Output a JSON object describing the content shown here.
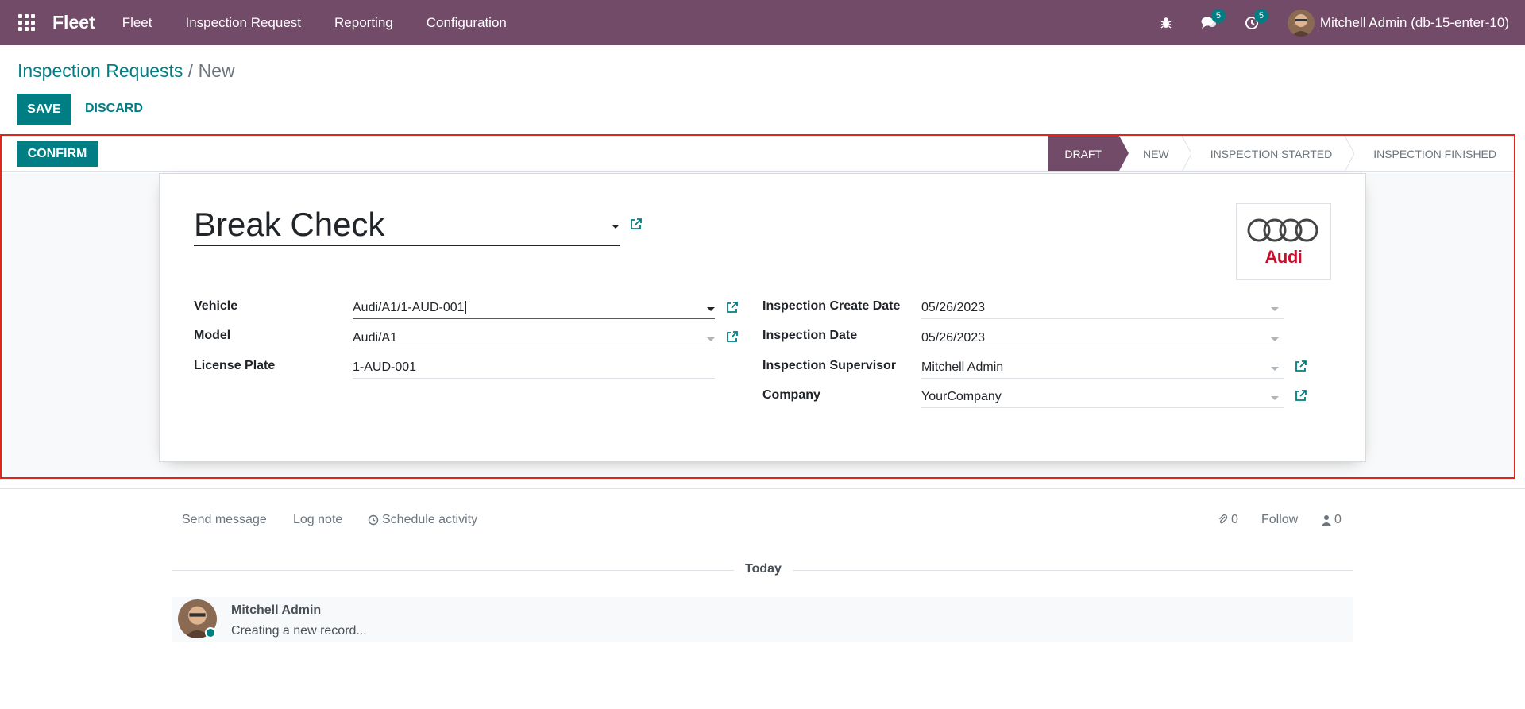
{
  "topbar": {
    "brand": "Fleet",
    "menu": [
      "Fleet",
      "Inspection Request",
      "Reporting",
      "Configuration"
    ],
    "messages_count": "5",
    "activities_count": "5",
    "user": "Mitchell Admin (db-15-enter-10)"
  },
  "breadcrumb": {
    "parent": "Inspection Requests",
    "separator": "/",
    "current": "New"
  },
  "actions": {
    "save": "SAVE",
    "discard": "DISCARD",
    "confirm": "CONFIRM"
  },
  "stages": [
    "DRAFT",
    "NEW",
    "INSPECTION STARTED",
    "INSPECTION FINISHED"
  ],
  "form": {
    "title": "Break Check",
    "logo_text": "Audi",
    "left": [
      {
        "label": "Vehicle",
        "value": "Audi/A1/1-AUD-001"
      },
      {
        "label": "Model",
        "value": "Audi/A1"
      },
      {
        "label": "License Plate",
        "value": "1-AUD-001"
      }
    ],
    "right": [
      {
        "label": "Inspection Create Date",
        "value": "05/26/2023"
      },
      {
        "label": "Inspection Date",
        "value": "05/26/2023"
      },
      {
        "label": "Inspection Supervisor",
        "value": "Mitchell Admin"
      },
      {
        "label": "Company",
        "value": "YourCompany"
      }
    ]
  },
  "chatter": {
    "send_message": "Send message",
    "log_note": "Log note",
    "schedule_activity": "Schedule activity",
    "attachments_count": "0",
    "follow": "Follow",
    "followers_count": "0",
    "date_separator": "Today",
    "message_author": "Mitchell Admin",
    "message_body": "Creating a new record..."
  },
  "colors": {
    "primary": "#714b67",
    "accent": "#017e84",
    "highlight_frame": "#e1251b"
  }
}
